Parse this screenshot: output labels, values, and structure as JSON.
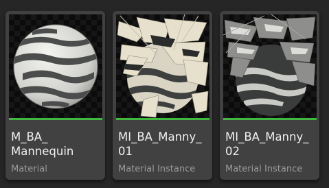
{
  "colors": {
    "background": "#262626",
    "tile": "#414141",
    "accent_material": "#3fb93f",
    "accent_instance": "#3fb93f",
    "name_text": "#f0f0f0",
    "type_text": "#9a9a9a"
  },
  "assets": [
    {
      "name": "M_BA_\nMannequin",
      "type": "Material",
      "icon": "material-sphere-thumbnail"
    },
    {
      "name": "MI_BA_Manny_\n01",
      "type": "Material Instance",
      "icon": "material-instance-thumbnail"
    },
    {
      "name": "MI_BA_Manny_\n02",
      "type": "Material Instance",
      "icon": "material-instance-thumbnail"
    }
  ]
}
